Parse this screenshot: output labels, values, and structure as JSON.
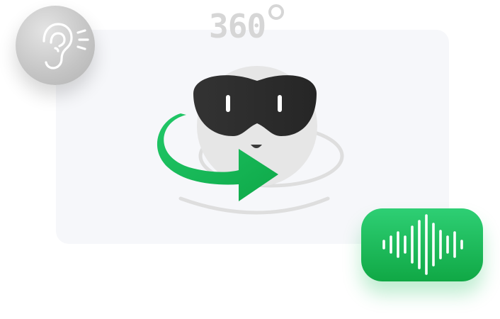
{
  "badge": {
    "text": "360",
    "icon": "degree-ring-icon"
  },
  "icons": {
    "hearing": "ear-icon",
    "character": "vr-headset-mascot-icon",
    "rotate": "rotate-arrow-icon",
    "audio": "sound-wave-icon"
  },
  "colors": {
    "card_bg": "#f6f7fa",
    "accent_green": "#1ab556",
    "headset_dark": "#2b2b2b",
    "label_gray": "#d6d6d6"
  }
}
